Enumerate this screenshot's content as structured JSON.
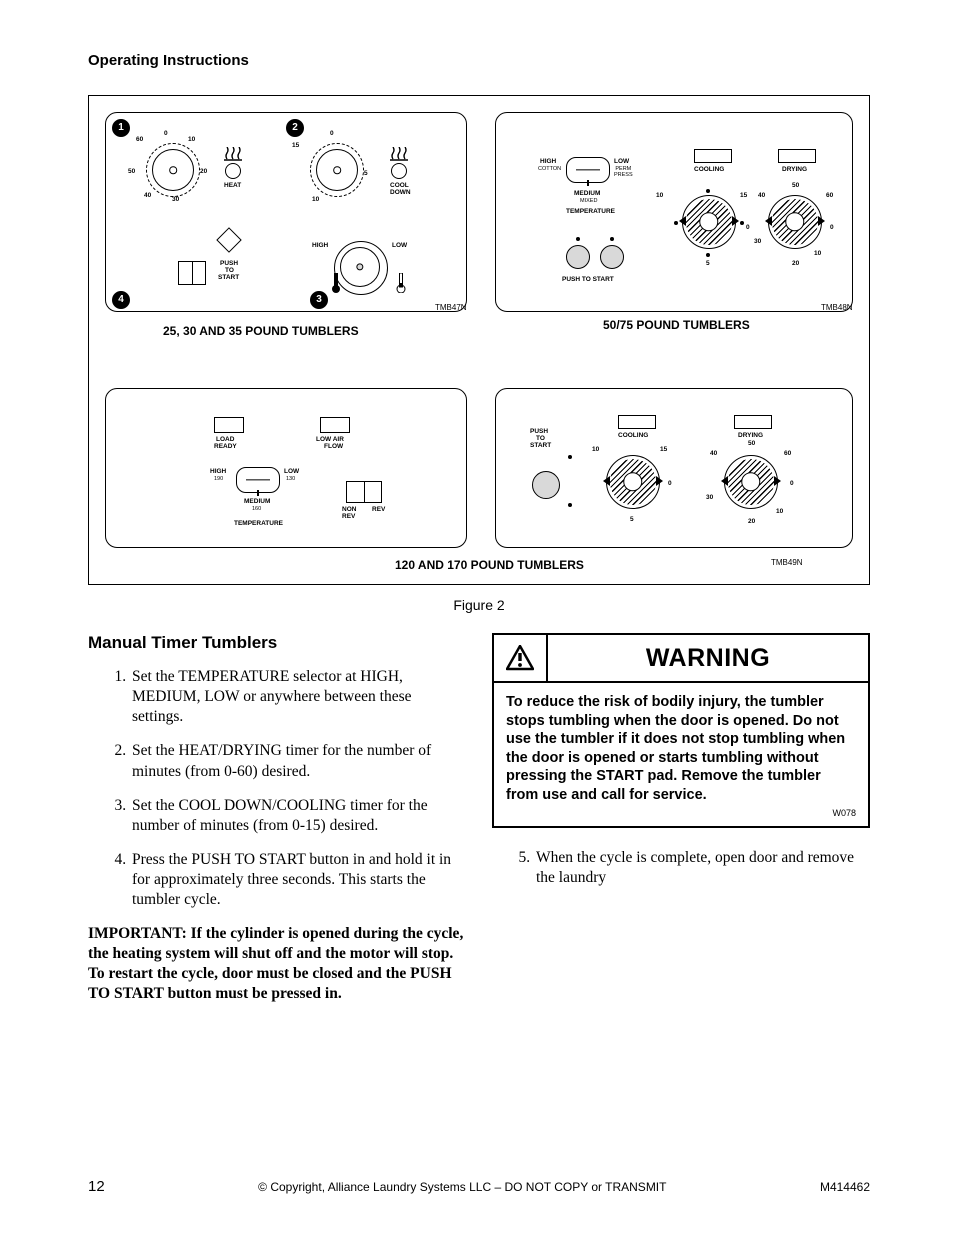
{
  "header": {
    "title": "Operating Instructions"
  },
  "figure": {
    "caption": "Figure 2",
    "panels": {
      "tl": {
        "caption": "25, 30 AND 35 POUND TUMBLERS",
        "part": "TMB47N",
        "callouts": {
          "c1": "1",
          "c2": "2",
          "c3": "3",
          "c4": "4"
        },
        "heat": {
          "label": "HEAT",
          "marks": {
            "m0": "0",
            "m10": "10",
            "m20": "20",
            "m30": "30",
            "m40": "40",
            "m50": "50",
            "m60": "60"
          }
        },
        "cooldown": {
          "label_l1": "COOL",
          "label_l2": "DOWN",
          "marks": {
            "m0": "0",
            "m5": "5",
            "m10": "10",
            "m15": "15"
          }
        },
        "push": {
          "l1": "PUSH",
          "l2": "TO",
          "l3": "START"
        },
        "temp": {
          "high": "HIGH",
          "low": "LOW"
        }
      },
      "tr": {
        "caption": "50/75 POUND TUMBLERS",
        "part": "TMB48N",
        "temp": {
          "high": "HIGH",
          "high_sub": "COTTON",
          "low": "LOW",
          "low_sub": "PERM\nPRESS",
          "medium": "MEDIUM",
          "medium_sub": "MIXED",
          "label": "TEMPERATURE"
        },
        "cooling": "COOLING",
        "drying": "DRYING",
        "push": "PUSH TO START",
        "drymarks": {
          "m0": "0",
          "m10": "10",
          "m20": "20",
          "m30": "30",
          "m40": "40",
          "m50": "50",
          "m60": "60"
        },
        "coolmarks": {
          "m0": "0",
          "m5": "5",
          "m10": "10",
          "m15": "15"
        }
      },
      "bl": {
        "load": {
          "l1": "LOAD",
          "l2": "READY"
        },
        "lowair": {
          "l1": "LOW AIR",
          "l2": "FLOW"
        },
        "temp": {
          "high": "HIGH",
          "high_sub": "190",
          "low": "LOW",
          "low_sub": "130",
          "medium": "MEDIUM",
          "medium_sub": "160",
          "label": "TEMPERATURE"
        },
        "nonrev": {
          "l1": "NON",
          "l2": "REV"
        },
        "rev": "REV"
      },
      "br": {
        "caption": "120 AND 170 POUND TUMBLERS",
        "part": "TMB49N",
        "push": {
          "l1": "PUSH",
          "l2": "TO",
          "l3": "START"
        },
        "cooling": "COOLING",
        "drying": "DRYING",
        "drymarks": {
          "m0": "0",
          "m10": "10",
          "m20": "20",
          "m30": "30",
          "m40": "40",
          "m50": "50",
          "m60": "60"
        },
        "coolmarks": {
          "m0": "0",
          "m5": "5",
          "m10": "10",
          "m15": "15"
        }
      }
    }
  },
  "section": {
    "title": "Manual Timer Tumblers",
    "steps": [
      "Set the TEMPERATURE selector at HIGH, MEDIUM, LOW or anywhere between these settings.",
      "Set the HEAT/DRYING timer for the number of minutes (from 0-60) desired.",
      "Set the COOL DOWN/COOLING timer for the number of minutes (from 0-15) desired.",
      "Press the PUSH TO START button in and hold it in for approximately three seconds. This starts the tumbler cycle."
    ],
    "important": "IMPORTANT:  If the cylinder is opened during the cycle, the heating system will shut off and the motor will stop. To restart the cycle, door must be closed and the PUSH TO START button must be pressed in.",
    "step5": "When the cycle is complete, open door and remove the laundry"
  },
  "warning": {
    "title": "WARNING",
    "body": "To reduce the risk of bodily injury, the tumbler stops tumbling when the door is opened.  Do not use the tumbler if it does not stop tumbling when the door is opened or starts tumbling without pressing the START  pad.  Remove the tumbler from use and call for service.",
    "code": "W078"
  },
  "footer": {
    "page": "12",
    "copyright": "© Copyright, Alliance Laundry Systems LLC – DO NOT COPY or TRANSMIT",
    "doc": "M414462"
  }
}
